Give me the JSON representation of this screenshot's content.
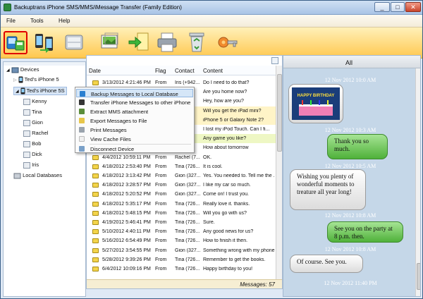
{
  "window": {
    "title": "Backuptrans iPhone SMS/MMS/iMessage Transfer (Family Edition)",
    "min": "_",
    "max": "□",
    "close": "✕"
  },
  "menu": [
    "File",
    "Tools",
    "Help"
  ],
  "toolbar": {
    "icons": [
      "backup-icon",
      "transfer-icon",
      "database-icon",
      "export-icon",
      "import-icon",
      "print-icon",
      "recycle-icon",
      "key-icon"
    ]
  },
  "tree": {
    "devices": "Devices",
    "phone1": "Ted's iPhone 5",
    "phone2": "Ted's iPhone 5S",
    "contacts": [
      "Kenny",
      "Tina",
      "Gion",
      "Rachel",
      "Bob",
      "Dick",
      "Iris"
    ],
    "local": "Local Databases"
  },
  "columns": {
    "date": "Date",
    "flag": "Flag",
    "contact": "Contact",
    "content": "Content"
  },
  "messages": [
    {
      "date": "3/13/2012 4:21:46 PM",
      "flag": "From",
      "contact": "Iris (+942...",
      "content": "Do I need to do that?"
    },
    {
      "date": "",
      "flag": "",
      "contact": "",
      "content": "Are you home now?"
    },
    {
      "date": "",
      "flag": "",
      "contact": "",
      "content": "Hey, how are you?"
    },
    {
      "date": "",
      "flag": "",
      "contact": "",
      "content": "Will you get the iPad mini?"
    },
    {
      "date": "",
      "flag": "",
      "contact": "",
      "content": "iPhone 5 or Galaxy Note 2?"
    },
    {
      "date": "",
      "flag": "",
      "contact": "",
      "content": "I lost my iPod Touch. Can I fi..."
    },
    {
      "date": "",
      "flag": "",
      "contact": "",
      "content": "Any game you like?"
    },
    {
      "date": "",
      "flag": "",
      "contact": "",
      "content": "How about tomorrow"
    },
    {
      "date": "4/4/2012 10:59:11 PM",
      "flag": "From",
      "contact": "Rachel (7...",
      "content": "OK."
    },
    {
      "date": "4/18/2012 2:53:40 PM",
      "flag": "From",
      "contact": "Tina (726...",
      "content": "It is cool."
    },
    {
      "date": "4/18/2012 3:13:42 PM",
      "flag": "From",
      "contact": "Gion (327...",
      "content": "Yes. You needed to. Tell me the ..."
    },
    {
      "date": "4/18/2012 3:28:57 PM",
      "flag": "From",
      "contact": "Gion (327...",
      "content": "I like my car so much."
    },
    {
      "date": "4/18/2012 5:20:52 PM",
      "flag": "From",
      "contact": "Gion (327...",
      "content": "Come on! I trust you."
    },
    {
      "date": "4/18/2012 5:35:17 PM",
      "flag": "From",
      "contact": "Tina (726...",
      "content": "Really love it. thanks."
    },
    {
      "date": "4/18/2012 5:48:15 PM",
      "flag": "From",
      "contact": "Tina (726...",
      "content": "Will you go with us?"
    },
    {
      "date": "4/19/2012 5:46:41 PM",
      "flag": "From",
      "contact": "Tina (726...",
      "content": "Sure."
    },
    {
      "date": "5/10/2012 4:40:11 PM",
      "flag": "From",
      "contact": "Tina (726...",
      "content": "Any good news for us?"
    },
    {
      "date": "5/16/2012 6:54:49 PM",
      "flag": "From",
      "contact": "Tina (726...",
      "content": "How to finish it then."
    },
    {
      "date": "5/27/2012 3:54:55 PM",
      "flag": "From",
      "contact": "Gion (327...",
      "content": "Something wrong with my phone"
    },
    {
      "date": "5/28/2012 9:39:26 PM",
      "flag": "From",
      "contact": "Tina (726...",
      "content": "Remember to get the books."
    },
    {
      "date": "6/4/2012 10:09:16 PM",
      "flag": "From",
      "contact": "Tina (726...",
      "content": "Happy birthday to you!"
    }
  ],
  "status": "Messages: 57",
  "context_menu": [
    "Backup Messages to Local Database",
    "Transfer iPhone Messages to other iPhone",
    "Extract MMS attachment",
    "Export Messages to File",
    "Print Messages",
    "View Cache Files",
    "Disconnect Device"
  ],
  "conversation": {
    "title": "All",
    "items": [
      {
        "type": "ts",
        "text": "12 Nov 2012 10:0 AM"
      },
      {
        "type": "image",
        "text": "HAPPY BIRTHDAY"
      },
      {
        "type": "ts",
        "text": "12 Nov 2012 10:3 AM"
      },
      {
        "type": "out",
        "text": "Thank you so much."
      },
      {
        "type": "ts",
        "text": "12 Nov 2012 10:5 AM"
      },
      {
        "type": "in",
        "text": "Wishing you plenty of wonderful moments to treature all year long!"
      },
      {
        "type": "ts",
        "text": "12 Nov 2012 10:8 AM"
      },
      {
        "type": "out",
        "text": "See you on the party at 8 p.m. then."
      },
      {
        "type": "ts",
        "text": "12 Nov 2012 10:8 AM"
      },
      {
        "type": "in",
        "text": "Of course. See you."
      },
      {
        "type": "ts",
        "text": "12 Nov 2012 11:40 PM"
      }
    ]
  }
}
